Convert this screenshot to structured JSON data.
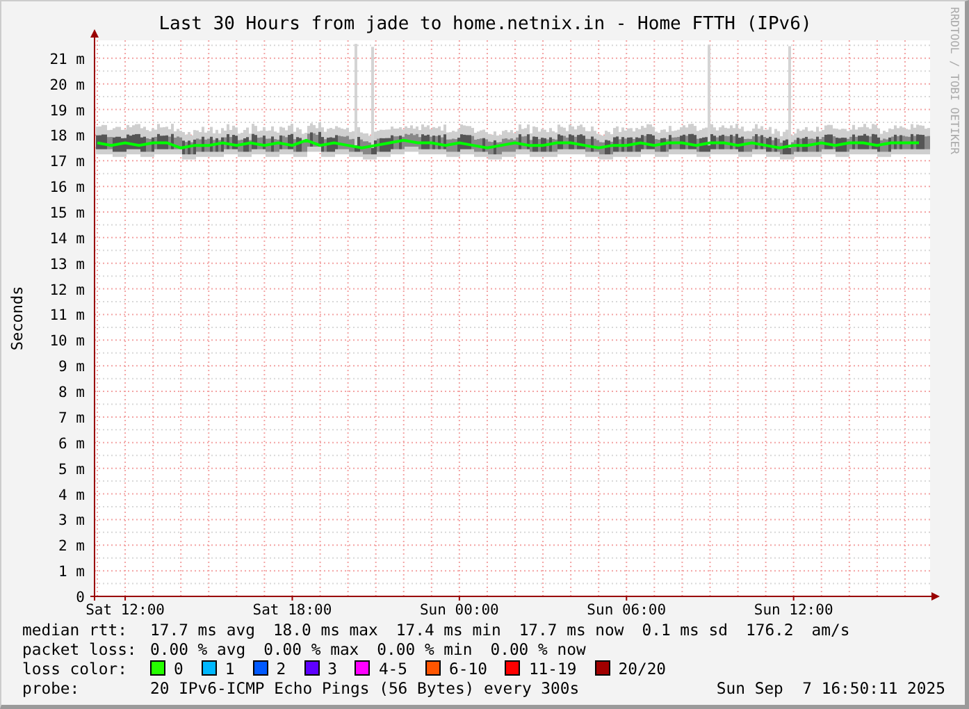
{
  "title": "Last 30 Hours from jade to home.netnix.in - Home FTTH (IPv6)",
  "credit": "RRDTOOL / TOBI OETIKER",
  "chart": {
    "chart_data": {
      "type": "line",
      "ylabel": "Seconds",
      "categories": [
        null,
        null,
        "Sat 12:00",
        null,
        null,
        null,
        null,
        null,
        null,
        null,
        null,
        null,
        null,
        null,
        "Sat 18:00",
        null,
        null,
        null,
        null,
        null,
        null,
        null,
        null,
        null,
        null,
        null,
        "Sun 00:00",
        null,
        null,
        null,
        null,
        null,
        null,
        null,
        null,
        null,
        null,
        null,
        "Sun 06:00",
        null,
        null,
        null,
        null,
        null,
        null,
        null,
        null,
        null,
        null,
        null,
        "Sun 12:00",
        null,
        null,
        null,
        null,
        null,
        null,
        null,
        null,
        null
      ],
      "series": [
        {
          "name": "median rtt:",
          "color": "#00ff00",
          "values": [
            17.7,
            17.6,
            17.7,
            17.6,
            17.7,
            17.7,
            17.5,
            17.6,
            17.6,
            17.7,
            17.6,
            17.7,
            17.6,
            17.7,
            17.6,
            17.8,
            17.6,
            17.7,
            17.6,
            17.5,
            17.6,
            17.7,
            17.8,
            17.7,
            17.7,
            17.6,
            17.7,
            17.6,
            17.5,
            17.6,
            17.7,
            17.6,
            17.6,
            17.7,
            17.7,
            17.6,
            17.5,
            17.6,
            17.6,
            17.7,
            17.6,
            17.7,
            17.7,
            17.6,
            17.7,
            17.7,
            17.6,
            17.7,
            17.6,
            17.5,
            17.6,
            17.6,
            17.7,
            17.6,
            17.7,
            17.7,
            17.6,
            17.7,
            17.7,
            17.7
          ]
        }
      ],
      "ylim": [
        0,
        21.7
      ],
      "grid": true,
      "yticks": [
        {
          "value": 0,
          "label": "0"
        },
        {
          "value": 1,
          "label": "1 m"
        },
        {
          "value": 2,
          "label": "2 m"
        },
        {
          "value": 3,
          "label": "3 m"
        },
        {
          "value": 4,
          "label": "4 m"
        },
        {
          "value": 5,
          "label": "5 m"
        },
        {
          "value": 6,
          "label": "6 m"
        },
        {
          "value": 7,
          "label": "7 m"
        },
        {
          "value": 8,
          "label": "8 m"
        },
        {
          "value": 9,
          "label": "9 m"
        },
        {
          "value": 10,
          "label": "10 m"
        },
        {
          "value": 11,
          "label": "11 m"
        },
        {
          "value": 12,
          "label": "12 m"
        },
        {
          "value": 13,
          "label": "13 m"
        },
        {
          "value": 14,
          "label": "14 m"
        },
        {
          "value": 15,
          "label": "15 m"
        },
        {
          "value": 16,
          "label": "16 m"
        },
        {
          "value": 17,
          "label": "17 m"
        },
        {
          "value": 18,
          "label": "18 m"
        },
        {
          "value": 19,
          "label": "19 m"
        },
        {
          "value": 20,
          "label": "20 m"
        },
        {
          "value": 21,
          "label": "21 m"
        }
      ]
    }
  },
  "legend": {
    "median_rtt": {
      "values": [
        "17.7 ms avg",
        "18.0 ms max",
        "17.4 ms min",
        "17.7 ms now",
        "0.1 ms sd",
        "176.2",
        "am/s"
      ]
    },
    "packet_loss": {
      "label": "packet loss:",
      "values": [
        "0.00 % avg",
        "0.00 % max",
        "0.00 % min",
        "0.00 % now"
      ]
    },
    "loss_color": {
      "label": "loss color:",
      "items": [
        {
          "label": "0",
          "color": "#26ff00"
        },
        {
          "label": "1",
          "color": "#00b8ff"
        },
        {
          "label": "2",
          "color": "#0059ff"
        },
        {
          "label": "3",
          "color": "#5e00ff"
        },
        {
          "label": "4-5",
          "color": "#ff00ff"
        },
        {
          "label": "6-10",
          "color": "#ff5500"
        },
        {
          "label": "11-19",
          "color": "#ff0000"
        },
        {
          "label": "20/20",
          "color": "#a10000"
        }
      ]
    },
    "probe": {
      "label": "probe:",
      "value": "20 IPv6-ICMP Echo Pings (56 Bytes) every 300s",
      "timestamp": "Sun Sep  7 16:50:11 2025"
    }
  }
}
